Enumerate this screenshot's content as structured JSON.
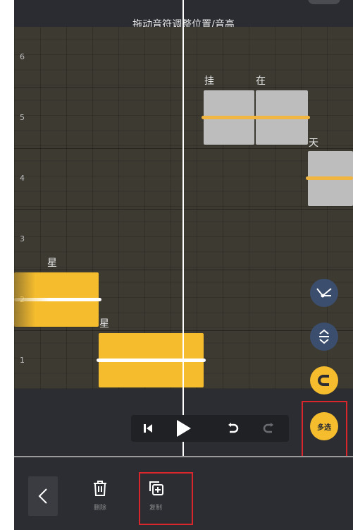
{
  "hint": "拖动音符调整位置/音高",
  "pitch_labels": [
    "6",
    "5",
    "4",
    "3",
    "2",
    "1"
  ],
  "lyrics": [
    "挂",
    "在",
    "天",
    "星",
    "星"
  ],
  "tools": {
    "multi_select_label": "多选"
  },
  "bottom": {
    "delete_label": "删除",
    "copy_label": "复制"
  },
  "colors": {
    "note_yellow": "#f5bc2d",
    "note_gray": "#bdbdbd",
    "pitch_line_orange": "#f0b641",
    "highlight_red": "#d8262c"
  },
  "icons": [
    "skip-back-icon",
    "play-icon",
    "undo-icon",
    "redo-icon",
    "curve-tool-icon",
    "vertical-stretch-icon",
    "magnet-icon",
    "back-chevron-icon",
    "trash-icon",
    "copy-icon"
  ]
}
